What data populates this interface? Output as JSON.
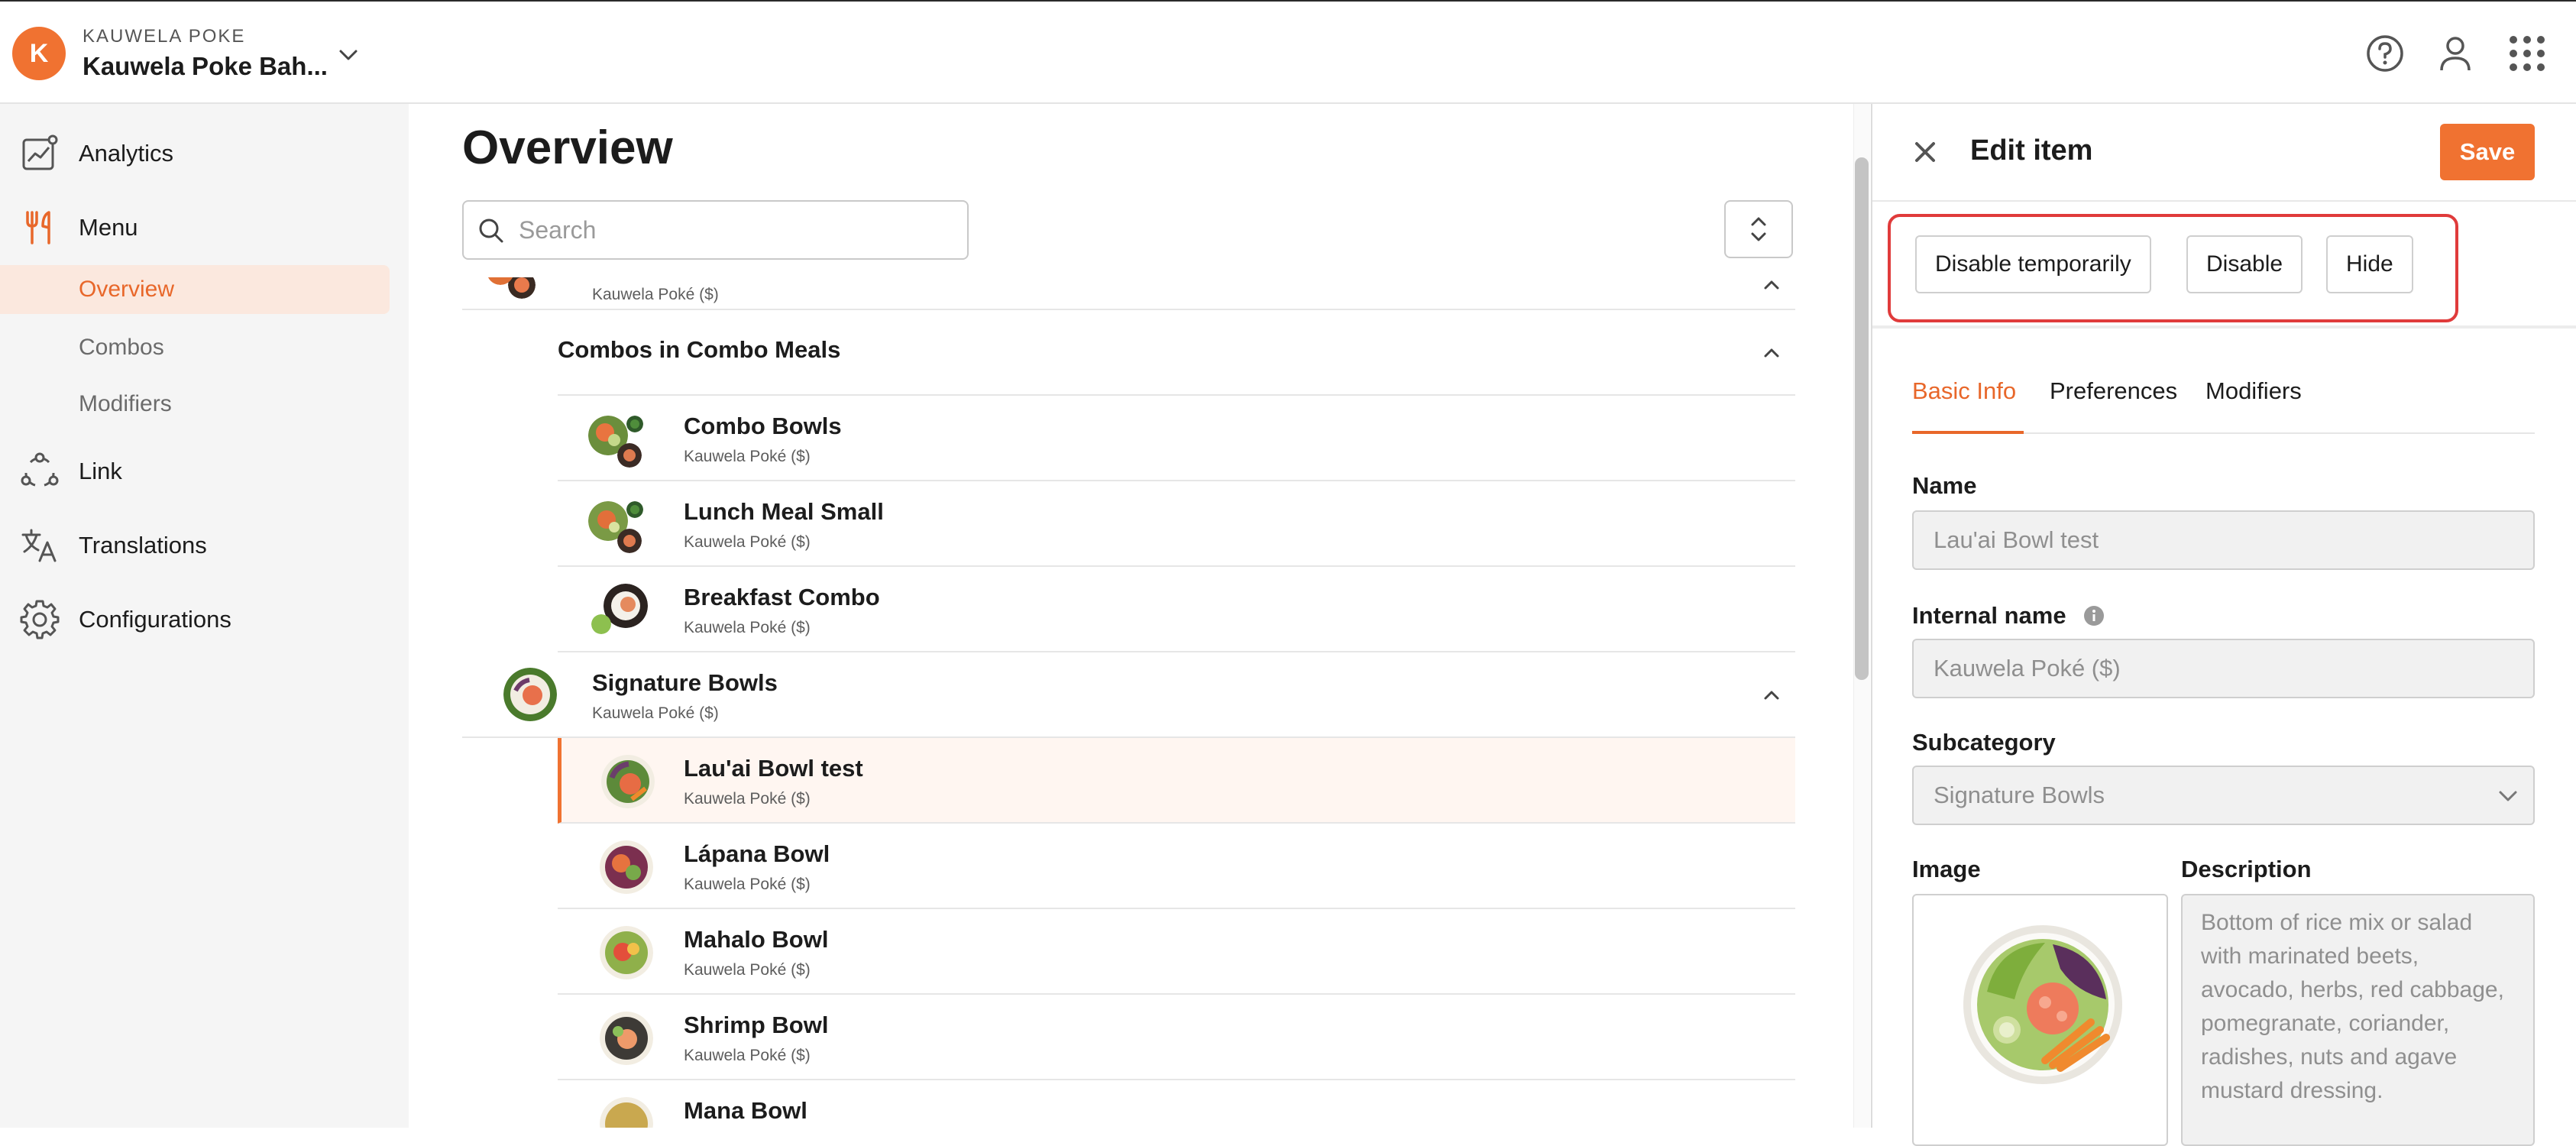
{
  "header": {
    "avatar_letter": "K",
    "org_label": "KAUWELA POKE",
    "store_name": "Kauwela Poke Bah...",
    "icons": [
      "chevron-down-icon",
      "help-icon",
      "user-icon",
      "apps-grid-icon"
    ]
  },
  "sidebar": {
    "items": [
      {
        "label": "Analytics",
        "icon": "analytics-icon"
      },
      {
        "label": "Menu",
        "icon": "fork-knife-icon"
      },
      {
        "label": "Link",
        "icon": "link-nodes-icon"
      },
      {
        "label": "Translations",
        "icon": "translate-icon"
      },
      {
        "label": "Configurations",
        "icon": "gear-icon"
      }
    ],
    "menu_sub": [
      {
        "label": "Overview",
        "active": true
      },
      {
        "label": "Combos",
        "active": false
      },
      {
        "label": "Modifiers",
        "active": false
      }
    ],
    "accent_color": "#e8672a"
  },
  "main": {
    "title": "Overview",
    "search_placeholder": "Search",
    "list": {
      "partial_top_sub": "Kauwela Poké ($)",
      "combos_header": "Combos in Combo Meals",
      "combos": [
        {
          "name": "Combo Bowls",
          "sub": "Kauwela Poké ($)"
        },
        {
          "name": "Lunch Meal Small",
          "sub": "Kauwela Poké ($)"
        },
        {
          "name": "Breakfast Combo",
          "sub": "Kauwela Poké ($)"
        }
      ],
      "category": {
        "name": "Signature Bowls",
        "sub": "Kauwela Poké ($)"
      },
      "items": [
        {
          "name": "Lau'ai Bowl test",
          "sub": "Kauwela Poké ($)",
          "selected": true
        },
        {
          "name": "Lápana Bowl",
          "sub": "Kauwela Poké ($)",
          "selected": false
        },
        {
          "name": "Mahalo Bowl",
          "sub": "Kauwela Poké ($)",
          "selected": false
        },
        {
          "name": "Shrimp Bowl",
          "sub": "Kauwela Poké ($)",
          "selected": false
        },
        {
          "name": "Mana Bowl",
          "sub": "",
          "selected": false
        }
      ]
    }
  },
  "panel": {
    "title": "Edit item",
    "save_label": "Save",
    "actions": [
      "Disable temporarily",
      "Disable",
      "Hide"
    ],
    "tabs": [
      {
        "label": "Basic Info",
        "active": true
      },
      {
        "label": "Preferences",
        "active": false
      },
      {
        "label": "Modifiers",
        "active": false
      }
    ],
    "fields": {
      "name_label": "Name",
      "name_value": "Lau'ai Bowl test",
      "internal_label": "Internal name",
      "internal_value": "Kauwela Poké ($)",
      "subcategory_label": "Subcategory",
      "subcategory_value": "Signature Bowls",
      "image_label": "Image",
      "description_label": "Description",
      "description_value": "Bottom of rice mix or salad with marinated beets, avocado, herbs, red cabbage, pomegranate, coriander, radishes, nuts and agave mustard dressing."
    },
    "highlight_color": "#e03b3b",
    "save_color": "#f07231"
  }
}
